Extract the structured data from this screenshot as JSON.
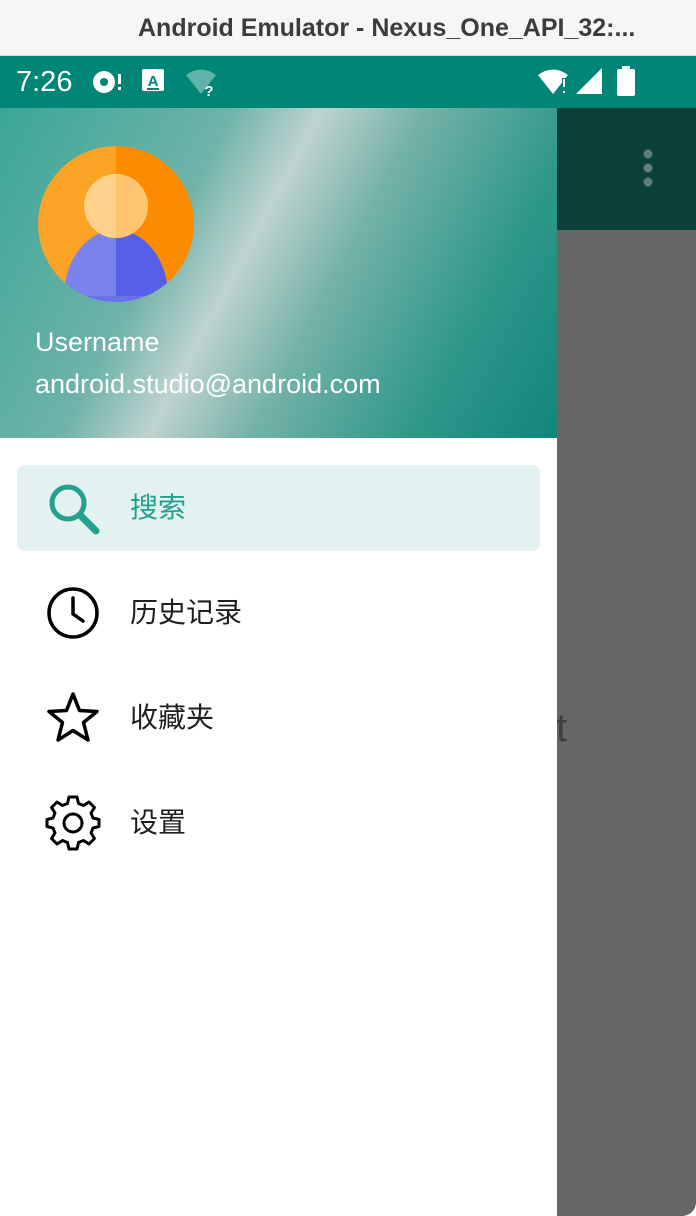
{
  "window": {
    "title": "Android Emulator - Nexus_One_API_32:..."
  },
  "status_bar": {
    "time": "7:26",
    "icons": [
      "sync-icon",
      "keyboard-a-icon",
      "wifi-question-icon",
      "wifi-alert-icon",
      "cell-signal-icon",
      "battery-icon"
    ]
  },
  "drawer": {
    "header": {
      "username": "Username",
      "email": "android.studio@android.com"
    },
    "items": [
      {
        "label": "搜索",
        "icon": "search-icon",
        "selected": true
      },
      {
        "label": "历史记录",
        "icon": "clock-icon",
        "selected": false
      },
      {
        "label": "收藏夹",
        "icon": "star-icon",
        "selected": false
      },
      {
        "label": "设置",
        "icon": "gear-icon",
        "selected": false
      }
    ]
  },
  "background_app": {
    "partial_text": "t"
  },
  "colors": {
    "status_bar": "#008577",
    "accent": "#26a08e",
    "selected_bg": "#e3f2f0",
    "scrim": "#666666"
  }
}
